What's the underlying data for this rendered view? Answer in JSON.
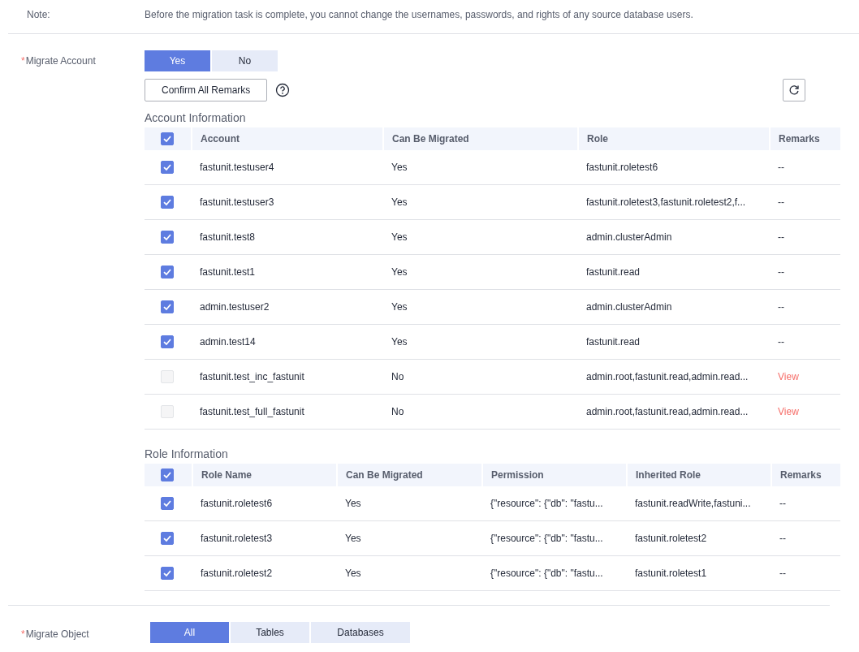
{
  "note": {
    "label": "Note:",
    "text": "Before the migration task is complete, you cannot change the usernames, passwords, and rights of any source database users."
  },
  "migrate_account": {
    "required_mark": "*",
    "label": "Migrate Account",
    "options": [
      {
        "label": "Yes",
        "selected": true
      },
      {
        "label": "No",
        "selected": false
      }
    ]
  },
  "confirm_button": "Confirm All Remarks",
  "account_table": {
    "title": "Account Information",
    "header_checked": true,
    "columns": [
      "Account",
      "Can Be Migrated",
      "Role",
      "Remarks"
    ],
    "rows": [
      {
        "checked": true,
        "disabled": false,
        "cells": [
          "fastunit.testuser4",
          "Yes",
          "fastunit.roletest6"
        ],
        "remarks": {
          "kind": "text",
          "text": "--"
        }
      },
      {
        "checked": true,
        "disabled": false,
        "cells": [
          "fastunit.testuser3",
          "Yes",
          "fastunit.roletest3,fastunit.roletest2,f..."
        ],
        "remarks": {
          "kind": "text",
          "text": "--"
        }
      },
      {
        "checked": true,
        "disabled": false,
        "cells": [
          "fastunit.test8",
          "Yes",
          "admin.clusterAdmin"
        ],
        "remarks": {
          "kind": "text",
          "text": "--"
        }
      },
      {
        "checked": true,
        "disabled": false,
        "cells": [
          "fastunit.test1",
          "Yes",
          "fastunit.read"
        ],
        "remarks": {
          "kind": "text",
          "text": "--"
        }
      },
      {
        "checked": true,
        "disabled": false,
        "cells": [
          "admin.testuser2",
          "Yes",
          "admin.clusterAdmin"
        ],
        "remarks": {
          "kind": "text",
          "text": "--"
        }
      },
      {
        "checked": true,
        "disabled": false,
        "cells": [
          "admin.test14",
          "Yes",
          "fastunit.read"
        ],
        "remarks": {
          "kind": "text",
          "text": "--"
        }
      },
      {
        "checked": false,
        "disabled": true,
        "cells": [
          "fastunit.test_inc_fastunit",
          "No",
          "admin.root,fastunit.read,admin.read..."
        ],
        "remarks": {
          "kind": "link",
          "text": "View"
        }
      },
      {
        "checked": false,
        "disabled": true,
        "cells": [
          "fastunit.test_full_fastunit",
          "No",
          "admin.root,fastunit.read,admin.read..."
        ],
        "remarks": {
          "kind": "link",
          "text": "View"
        }
      }
    ]
  },
  "role_table": {
    "title": "Role Information",
    "header_checked": true,
    "columns": [
      "Role Name",
      "Can Be Migrated",
      "Permission",
      "Inherited Role",
      "Remarks"
    ],
    "rows": [
      {
        "checked": true,
        "disabled": false,
        "cells": [
          "fastunit.roletest6",
          "Yes",
          "{\"resource\": {\"db\": \"fastu...",
          "fastunit.readWrite,fastuni..."
        ],
        "remarks": {
          "kind": "text",
          "text": "--"
        }
      },
      {
        "checked": true,
        "disabled": false,
        "cells": [
          "fastunit.roletest3",
          "Yes",
          "{\"resource\": {\"db\": \"fastu...",
          "fastunit.roletest2"
        ],
        "remarks": {
          "kind": "text",
          "text": "--"
        }
      },
      {
        "checked": true,
        "disabled": false,
        "cells": [
          "fastunit.roletest2",
          "Yes",
          "{\"resource\": {\"db\": \"fastu...",
          "fastunit.roletest1"
        ],
        "remarks": {
          "kind": "text",
          "text": "--"
        }
      }
    ]
  },
  "migrate_object": {
    "required_mark": "*",
    "label": "Migrate Object",
    "options": [
      {
        "label": "All",
        "selected": true
      },
      {
        "label": "Tables",
        "selected": false
      },
      {
        "label": "Databases",
        "selected": false
      }
    ]
  }
}
